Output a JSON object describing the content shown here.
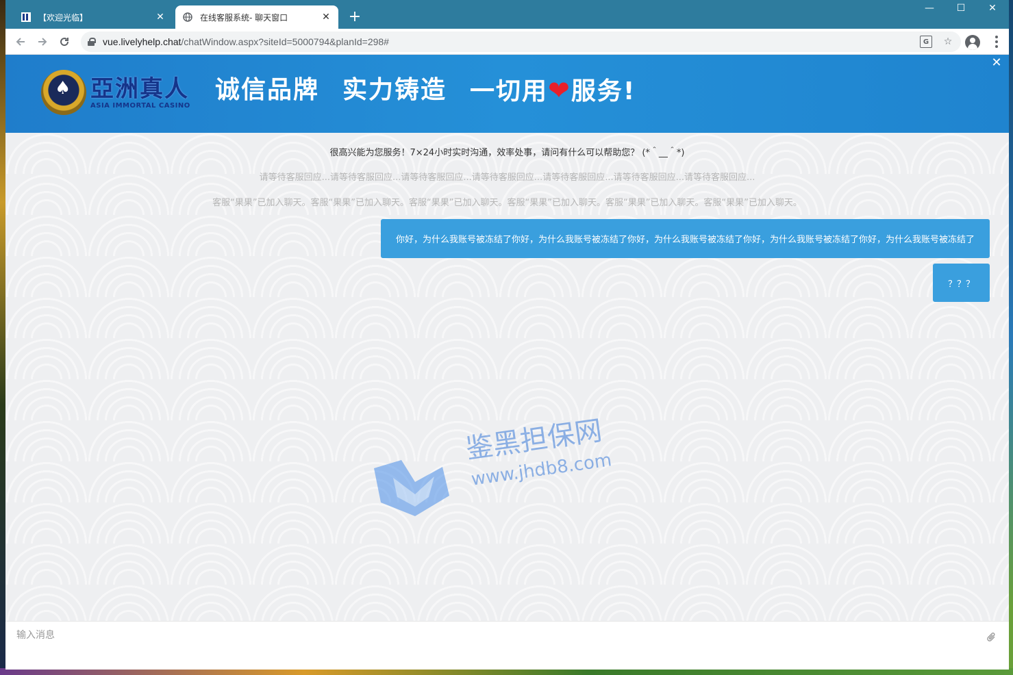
{
  "browser": {
    "tabs": [
      {
        "title": "【欢迎光临】",
        "active": false
      },
      {
        "title": "在线客服系统- 聊天窗口",
        "active": true
      }
    ],
    "new_tab": "+",
    "close": "✕",
    "url_host": "vue.livelyhelp.chat",
    "url_rest": "/chatWindow.aspx?siteId=5000794&planId=298#",
    "window_controls": {
      "minimize": "—",
      "maximize": "☐",
      "close": "✕"
    }
  },
  "banner": {
    "logo_cn": "亞洲真人",
    "logo_en": "ASIA IMMORTAL CASINO",
    "slogan_1": "诚信品牌",
    "slogan_2": "实力铸造",
    "slogan_3_a": "一切用",
    "slogan_3_b": "服务!",
    "heart": "❤",
    "close": "✕"
  },
  "chat": {
    "system_messages": [
      "很高兴能为您服务！7×24小时实时沟通，效率处事，请问有什么可以帮助您？ (*＾__＾*)",
      "请等待客服回应...请等待客服回应...请等待客服回应...请等待客服回应...请等待客服回应...请等待客服回应...请等待客服回应...",
      "客服“果果”已加入聊天。客服“果果”已加入聊天。客服“果果”已加入聊天。客服“果果”已加入聊天。客服“果果”已加入聊天。客服“果果”已加入聊天。"
    ],
    "user_messages": [
      "你好，为什么我账号被冻结了你好，为什么我账号被冻结了你好，为什么我账号被冻结了你好，为什么我账号被冻结了你好，为什么我账号被冻结了",
      "？？？"
    ],
    "watermark_cn": "鉴黑担保网",
    "watermark_url": "www.jhdb8.com"
  },
  "input": {
    "placeholder": "输入消息"
  },
  "colors": {
    "tabbar": "#2e7c9e",
    "banner": "#2590d8",
    "bubble": "#3a9fde"
  }
}
